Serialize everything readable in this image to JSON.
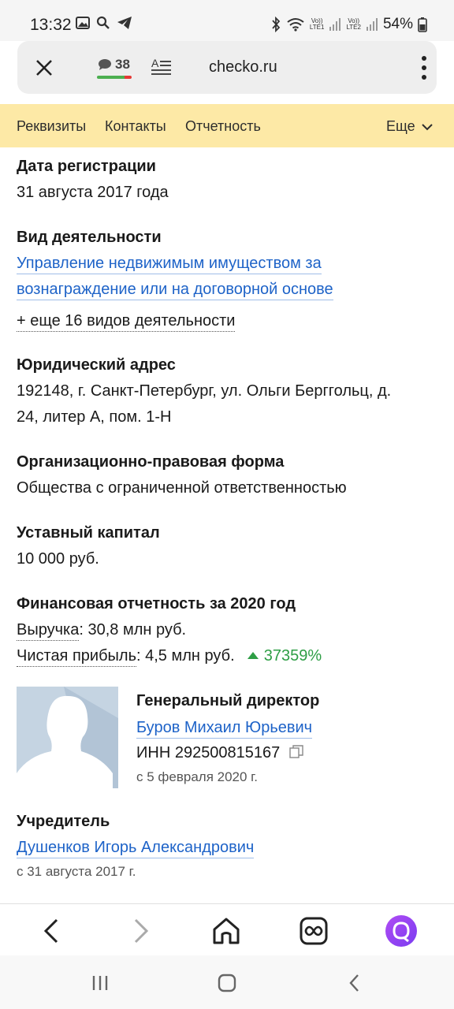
{
  "status_bar": {
    "time": "13:32",
    "battery": "54%",
    "sim1": "LTE1",
    "sim2": "LTE2",
    "volte": "Vo))",
    "icons": [
      "gallery-icon",
      "search-icon",
      "telegram-icon",
      "bluetooth-icon",
      "wifi-icon",
      "signal-icon",
      "battery-icon"
    ]
  },
  "browser": {
    "domain": "checko.ru",
    "comments_count": "38",
    "icons": [
      "close-icon",
      "comment-icon",
      "reader-mode-icon",
      "more-vertical-icon"
    ]
  },
  "site_nav": {
    "items": [
      "Реквизиты",
      "Контакты",
      "Отчетность"
    ],
    "more_label": "Еще"
  },
  "company": {
    "registration": {
      "label": "Дата регистрации",
      "value": "31 августа 2017 года"
    },
    "activity": {
      "label": "Вид деятельности",
      "line1": "Управление недвижимым имуществом за",
      "line2": "вознаграждение или на договорной основе",
      "more": "+ еще 16 видов деятельности"
    },
    "address": {
      "label": "Юридический адрес",
      "line1": "192148, г. Санкт-Петербург, ул. Ольги Берггольц, д.",
      "line2": "24, литер А, пом. 1-Н"
    },
    "legal_form": {
      "label": "Организационно-правовая форма",
      "value": "Общества с ограниченной ответственностью"
    },
    "capital": {
      "label": "Уставный капитал",
      "value": "10 000 руб."
    },
    "finance": {
      "label": "Финансовая отчетность за 2020 год",
      "revenue_label": "Выручка",
      "revenue_value": ": 30,8 млн руб.",
      "profit_label": "Чистая прибыль",
      "profit_value": ": 4,5 млн руб.",
      "profit_growth": "37359%"
    },
    "director": {
      "role": "Генеральный директор",
      "name": "Буров Михаил Юрьевич",
      "inn": "ИНН 292500815167",
      "since": "с 5 февраля 2020 г."
    },
    "founder": {
      "label": "Учредитель",
      "name": "Душенков Игорь Александрович",
      "since": "с 31 августа 2017 г."
    }
  },
  "colors": {
    "nav_bg": "#fde9a6",
    "link": "#1e63c8",
    "gain": "#2e9e45",
    "alice": "#9b45f2"
  }
}
